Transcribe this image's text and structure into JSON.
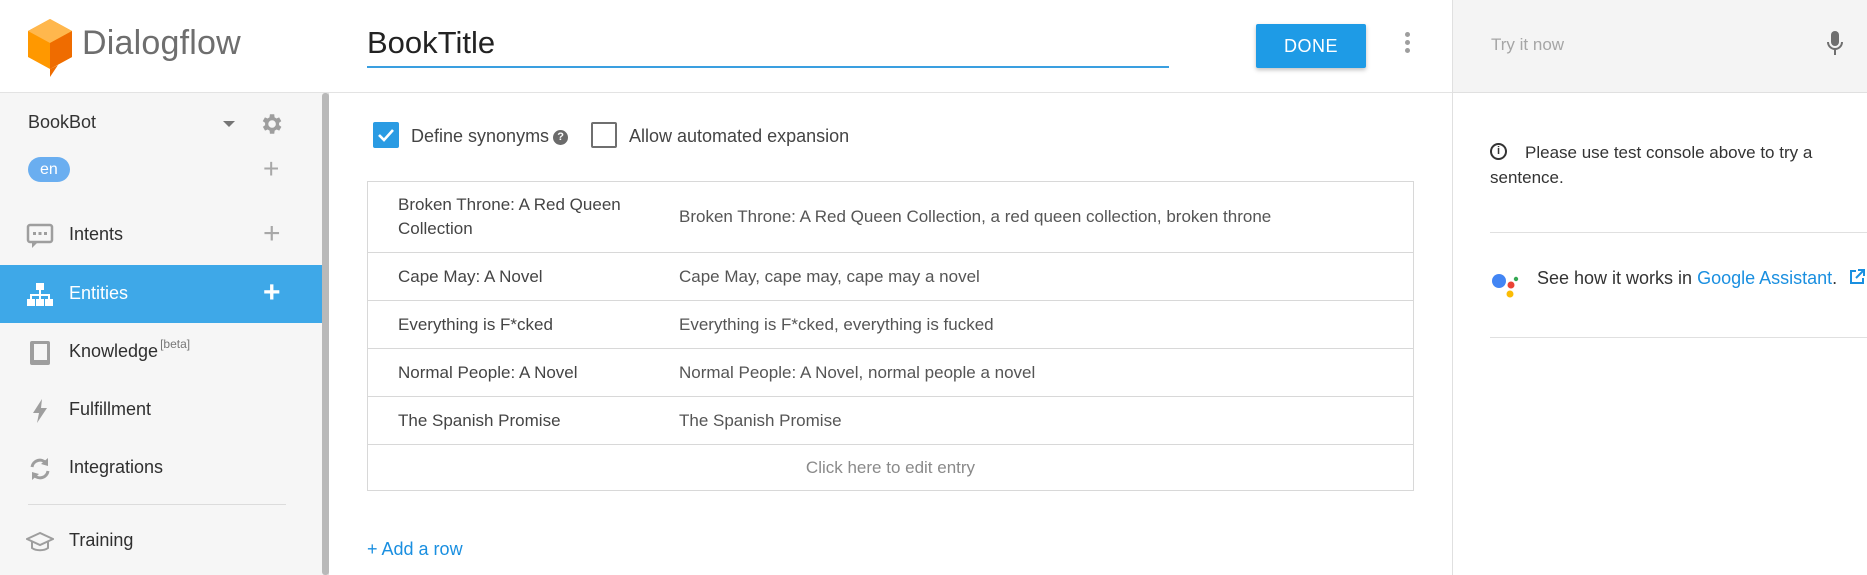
{
  "brand": {
    "name": "Dialogflow"
  },
  "sidebar": {
    "agent": "BookBot",
    "language": "en",
    "items": [
      {
        "label": "Intents",
        "plus": "+"
      },
      {
        "label": "Entities",
        "plus": "+"
      },
      {
        "label": "Knowledge",
        "badge": "[beta]"
      },
      {
        "label": "Fulfillment"
      },
      {
        "label": "Integrations"
      },
      {
        "label": "Training"
      }
    ],
    "lang_add": "+"
  },
  "header": {
    "entity_name": "BookTitle",
    "done_label": "DONE"
  },
  "options": {
    "define_synonyms": {
      "label": "Define synonyms",
      "checked": true
    },
    "automated_expansion": {
      "label": "Allow automated expansion",
      "checked": false
    }
  },
  "entries": [
    {
      "value": "Broken Throne: A Red Queen Collection",
      "synonyms": "Broken Throne: A Red Queen Collection, a red queen collection, broken throne"
    },
    {
      "value": "Cape May: A Novel",
      "synonyms": "Cape May, cape may, cape may a novel"
    },
    {
      "value": "Everything is F*cked",
      "synonyms": "Everything is F*cked, everything is fucked"
    },
    {
      "value": "Normal People: A Novel",
      "synonyms": "Normal People: A Novel, normal people a novel"
    },
    {
      "value": "The Spanish Promise",
      "synonyms": "The Spanish Promise"
    }
  ],
  "edit_entry_label": "Click here to edit entry",
  "add_row_label": "+ Add a row",
  "console": {
    "try_placeholder": "Try it now",
    "info_text": "Please use test console above to try a sentence.",
    "ga_prefix": "See how it works in ",
    "ga_link": "Google Assistant",
    "ga_suffix": "."
  },
  "colors": {
    "accent": "#3ea8e8",
    "button": "#1e9be6",
    "link": "#1a8fe0",
    "brand_orange": "#f57c00"
  }
}
